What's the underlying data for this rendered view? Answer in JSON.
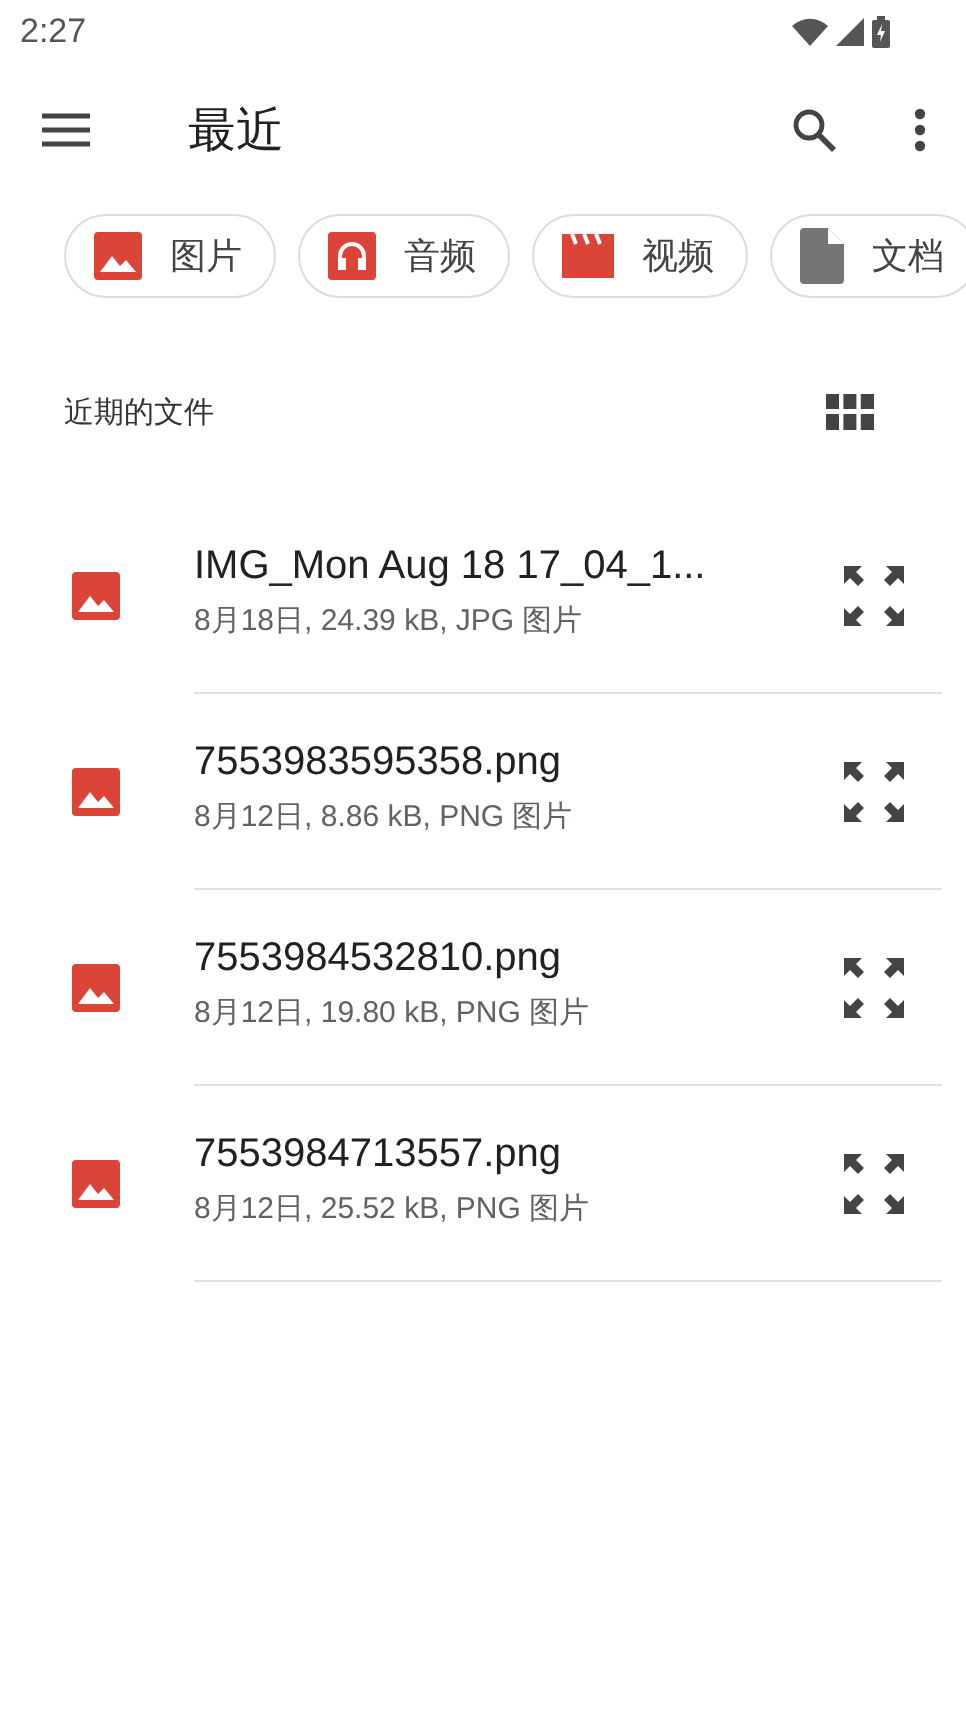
{
  "status_bar": {
    "time": "2:27"
  },
  "toolbar": {
    "title": "最近"
  },
  "chips": [
    {
      "kind": "image",
      "label": "图片"
    },
    {
      "kind": "audio",
      "label": "音频"
    },
    {
      "kind": "video",
      "label": "视频"
    },
    {
      "kind": "document",
      "label": "文档"
    }
  ],
  "section": {
    "title": "近期的文件"
  },
  "files": [
    {
      "name": "IMG_Mon Aug 18 17_04_1...",
      "details": "8月18日, 24.39 kB, JPG 图片"
    },
    {
      "name": "7553983595358.png",
      "details": "8月12日, 8.86 kB, PNG 图片"
    },
    {
      "name": "7553984532810.png",
      "details": "8月12日, 19.80 kB, PNG 图片"
    },
    {
      "name": "7553984713557.png",
      "details": "8月12日, 25.52 kB, PNG 图片"
    }
  ]
}
